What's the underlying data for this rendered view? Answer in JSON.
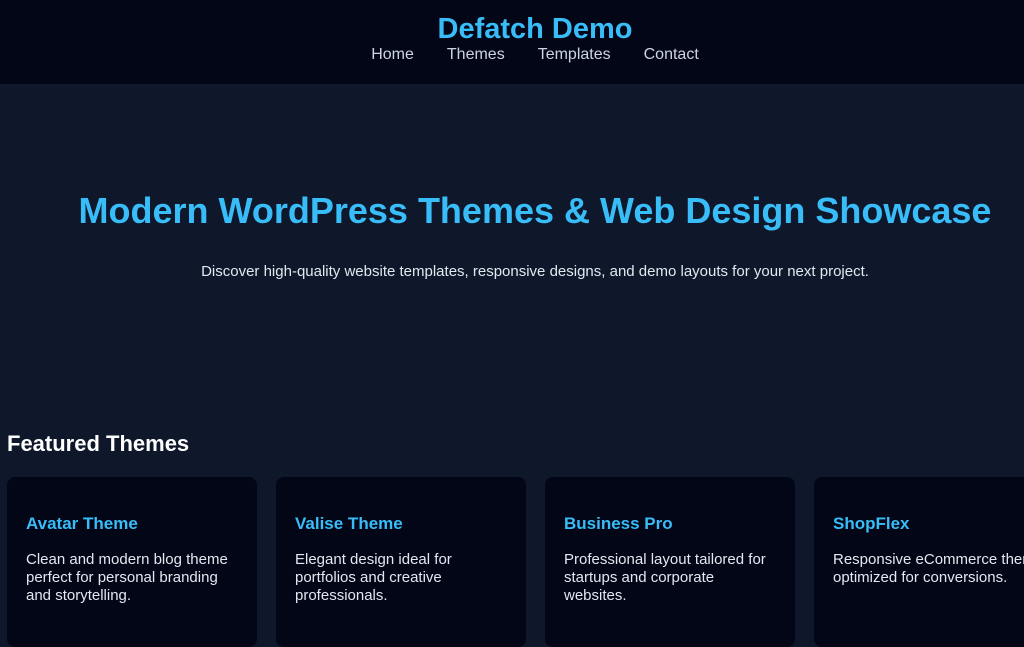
{
  "header": {
    "title": "Defatch Demo",
    "nav": [
      "Home",
      "Themes",
      "Templates",
      "Contact"
    ]
  },
  "hero": {
    "title": "Modern WordPress Themes & Web Design Showcase",
    "subtitle": "Discover high-quality website templates, responsive designs, and demo layouts for your next project."
  },
  "featured": {
    "title": "Featured Themes",
    "cards": [
      {
        "title": "Avatar Theme",
        "description": "Clean and modern blog theme perfect for personal branding and storytelling."
      },
      {
        "title": "Valise Theme",
        "description": "Elegant design ideal for portfolios and creative professionals."
      },
      {
        "title": "Business Pro",
        "description": "Professional layout tailored for startups and corporate websites."
      },
      {
        "title": "ShopFlex",
        "description": "Responsive eCommerce theme optimized for conversions."
      }
    ]
  },
  "colors": {
    "accent": "#38bdf8",
    "page_background": "#0f172a",
    "header_background": "#020617",
    "card_background": "#020617"
  }
}
